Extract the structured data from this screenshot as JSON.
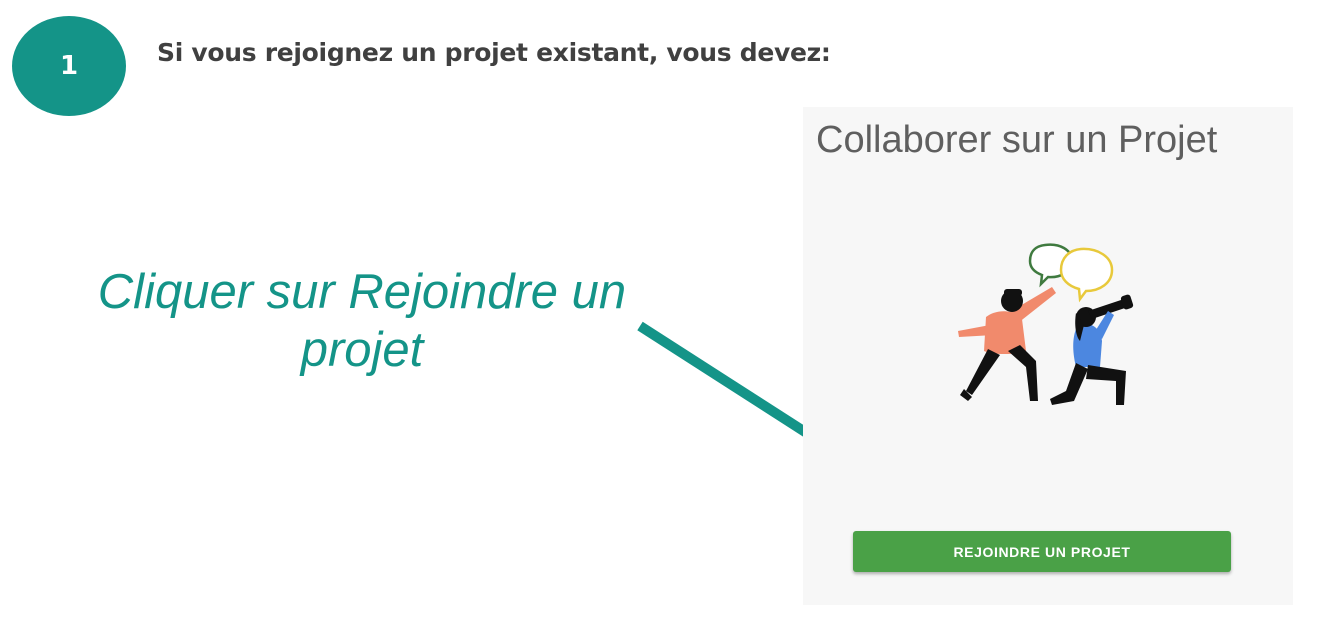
{
  "step": {
    "number": "1",
    "heading": "Si vous rejoignez un projet existant, vous devez:"
  },
  "instruction": {
    "line1": "Cliquer sur Rejoindre un",
    "line2": "projet"
  },
  "card": {
    "title": "Collaborer sur un Projet",
    "illustration": "collaboration-illustration",
    "button_label": "REJOINDRE UN PROJET"
  },
  "colors": {
    "accent": "#149488",
    "button": "#4aa147",
    "heading_text": "#404040",
    "card_background": "#f7f7f7"
  }
}
